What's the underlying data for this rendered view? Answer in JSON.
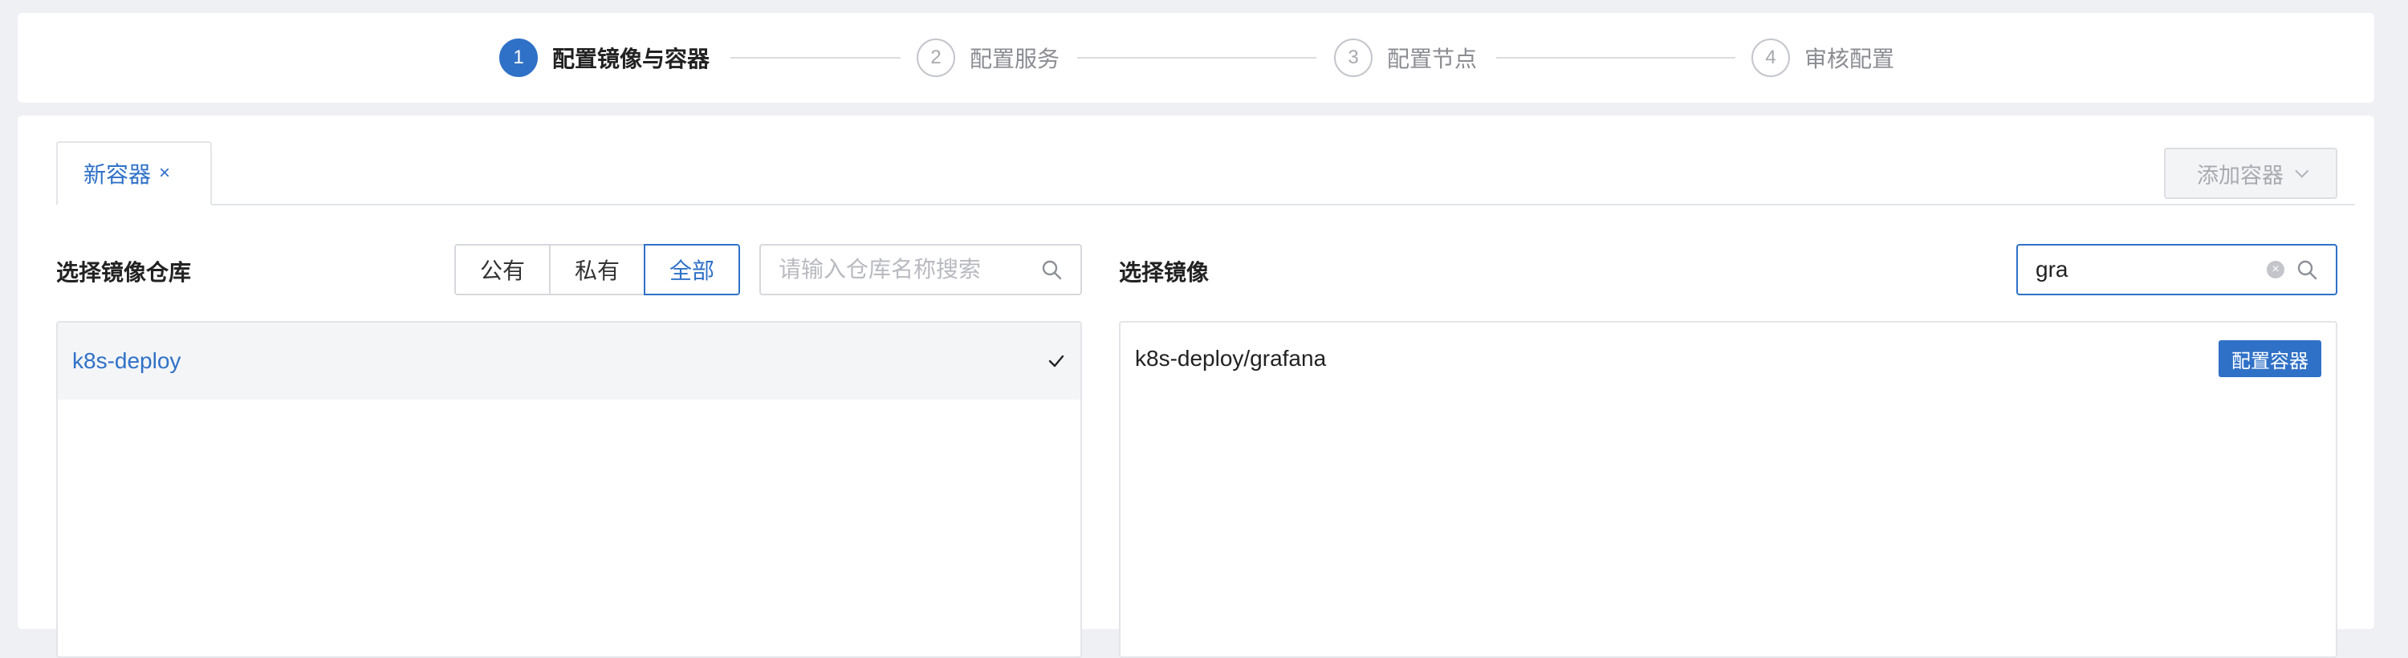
{
  "steps": [
    {
      "num": "1",
      "label": "配置镜像与容器",
      "active": true
    },
    {
      "num": "2",
      "label": "配置服务",
      "active": false
    },
    {
      "num": "3",
      "label": "配置节点",
      "active": false
    },
    {
      "num": "4",
      "label": "审核配置",
      "active": false
    }
  ],
  "tabs": {
    "new_container_label": "新容器",
    "close_glyph": "×"
  },
  "toolbar": {
    "add_container_label": "添加容器"
  },
  "repo_section": {
    "title": "选择镜像仓库",
    "filters": [
      "公有",
      "私有",
      "全部"
    ],
    "active_filter": "全部",
    "search_placeholder": "请输入仓库名称搜索",
    "items": [
      {
        "name": "k8s-deploy",
        "selected": true
      }
    ]
  },
  "image_section": {
    "title": "选择镜像",
    "search_value": "gra",
    "items": [
      {
        "name": "k8s-deploy/grafana",
        "action_label": "配置容器"
      }
    ]
  },
  "colors": {
    "accent": "#2f71c7",
    "background": "#eff0f4"
  }
}
